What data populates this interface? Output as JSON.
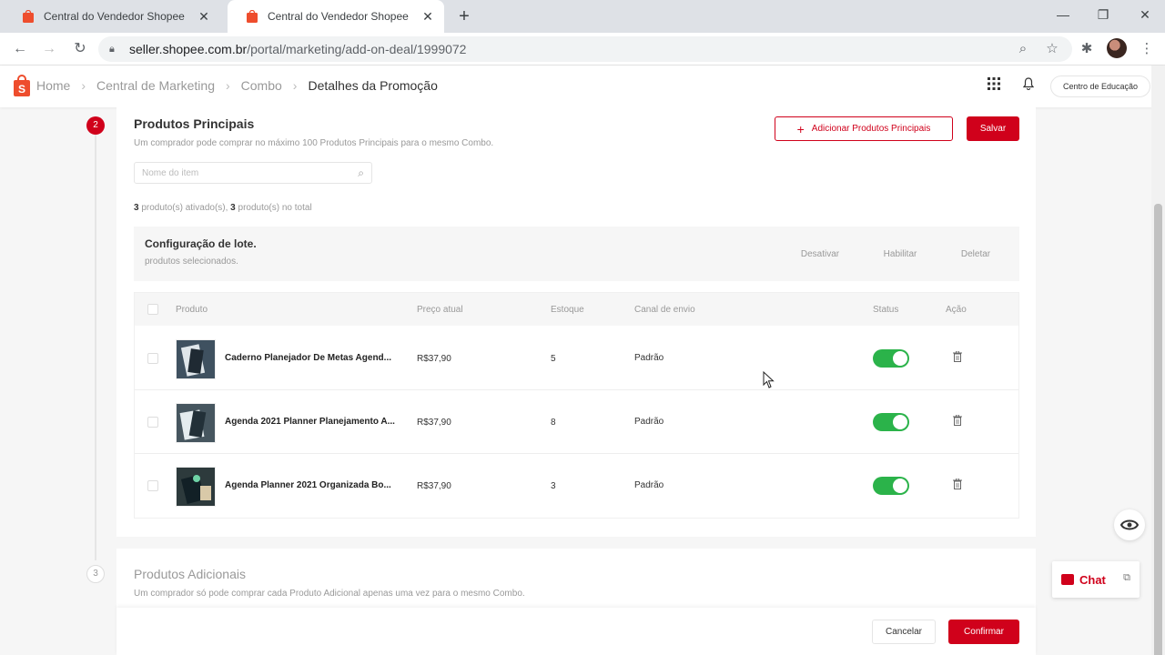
{
  "browser": {
    "tabs": [
      {
        "title": "Central do Vendedor Shopee",
        "active": false
      },
      {
        "title": "Central do Vendedor Shopee",
        "active": true
      }
    ],
    "url_host": "seller.shopee.com.br",
    "url_path": "/portal/marketing/add-on-deal/1999072"
  },
  "header": {
    "breadcrumbs": [
      "Home",
      "Central de Marketing",
      "Combo",
      "Detalhes da Promoção"
    ],
    "edu_button": "Centro de Educação"
  },
  "main": {
    "step_number": "2",
    "title": "Produtos Principais",
    "subtitle": "Um comprador pode comprar no máximo 100 Produtos Principais para o mesmo Combo.",
    "add_button": "Adicionar Produtos Principais",
    "save_button": "Salvar",
    "search_placeholder": "Nome do item",
    "count_activated": "3",
    "count_activated_text": " produto(s) ativado(s), ",
    "count_total": "3",
    "count_total_text": " produto(s) no total",
    "batch": {
      "title": "Configuração de lote.",
      "subtitle": "produtos selecionados.",
      "actions": [
        "Desativar",
        "Habilitar",
        "Deletar"
      ]
    },
    "table": {
      "columns": [
        "Produto",
        "Preço atual",
        "Estoque",
        "Canal de envio",
        "Status",
        "Ação"
      ],
      "rows": [
        {
          "name": "Caderno Planejador De Metas Agend...",
          "price": "R$37,90",
          "stock": "5",
          "channel": "Padrão",
          "status_on": true
        },
        {
          "name": "Agenda 2021 Planner Planejamento A...",
          "price": "R$37,90",
          "stock": "8",
          "channel": "Padrão",
          "status_on": true
        },
        {
          "name": "Agenda Planner 2021 Organizada Bo...",
          "price": "R$37,90",
          "stock": "3",
          "channel": "Padrão",
          "status_on": true
        }
      ]
    }
  },
  "additional": {
    "step_number": "3",
    "title": "Produtos Adicionais",
    "subtitle": "Um comprador só pode comprar cada Produto Adicional apenas uma vez para o mesmo Combo."
  },
  "footer": {
    "cancel": "Cancelar",
    "confirm": "Confirmar"
  },
  "chat": {
    "label": "Chat"
  },
  "colors": {
    "brand": "#d0011b",
    "toggle_on": "#2bb34a"
  }
}
